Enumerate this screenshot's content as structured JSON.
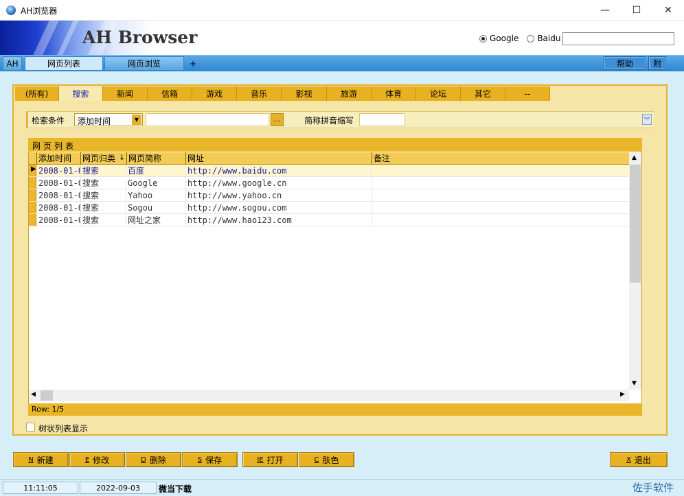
{
  "window": {
    "title": "AH浏览器",
    "minimize": "—",
    "maximize": "☐",
    "close": "✕"
  },
  "header": {
    "brand": "AH Browser",
    "engines": [
      {
        "label": "Google",
        "selected": true
      },
      {
        "label": "Baidu",
        "selected": false
      }
    ],
    "search_value": ""
  },
  "main_tabs": [
    {
      "label": "AH"
    },
    {
      "label": "网页列表",
      "active": true
    },
    {
      "label": "网页浏览"
    },
    {
      "label": "+"
    }
  ],
  "right_buttons": {
    "help": "帮助",
    "attach": "附"
  },
  "category_tabs": [
    "(所有)",
    "搜索",
    "新闻",
    "信箱",
    "游戏",
    "音乐",
    "影视",
    "旅游",
    "体育",
    "论坛",
    "其它",
    "--"
  ],
  "active_category": "搜索",
  "filter": {
    "label": "检索条件",
    "select_value": "添加时间",
    "text_value": "",
    "browse": "...",
    "abbr_label": "简称拼音缩写",
    "abbr_value": ""
  },
  "grid": {
    "title": "网页列表",
    "grip": "⠿",
    "columns": [
      "添加时间",
      "网页归类",
      "网页简称",
      "网址",
      "备注"
    ],
    "sort_indicator": "↓",
    "rows": [
      [
        "2008-01-0",
        "搜索",
        "百度",
        "http://www.baidu.com",
        ""
      ],
      [
        "2008-01-0",
        "搜索",
        "Google",
        "http://www.google.cn",
        ""
      ],
      [
        "2008-01-0",
        "搜索",
        "Yahoo",
        "http://www.yahoo.cn",
        ""
      ],
      [
        "2008-01-0",
        "搜索",
        "Sogou",
        "http://www.sogou.com",
        ""
      ],
      [
        "2008-01-0",
        "搜索",
        "网址之家",
        "http://www.hao123.com",
        ""
      ]
    ],
    "selected_row": 0,
    "row_status": "Row: 1/5"
  },
  "tree_view_label": "树状列表显示",
  "bottom_buttons": [
    {
      "key": "N",
      "label": "新建"
    },
    {
      "key": "E",
      "label": "修改"
    },
    {
      "key": "D",
      "label": "删除"
    },
    {
      "key": "S",
      "label": "保存"
    },
    {
      "key": "IE",
      "label": "打开"
    },
    {
      "key": "C",
      "label": "肤色"
    },
    {
      "key": "X",
      "label": "退出"
    }
  ],
  "status": {
    "time": "11:11:05",
    "date": "2022-09-03",
    "message": "微当下载",
    "corner": "佐手软件"
  },
  "colors": {
    "accent": "#e8b121",
    "panel": "#f5e6a8",
    "tabbar": "#2e86d0",
    "background": "#d6eef8"
  }
}
